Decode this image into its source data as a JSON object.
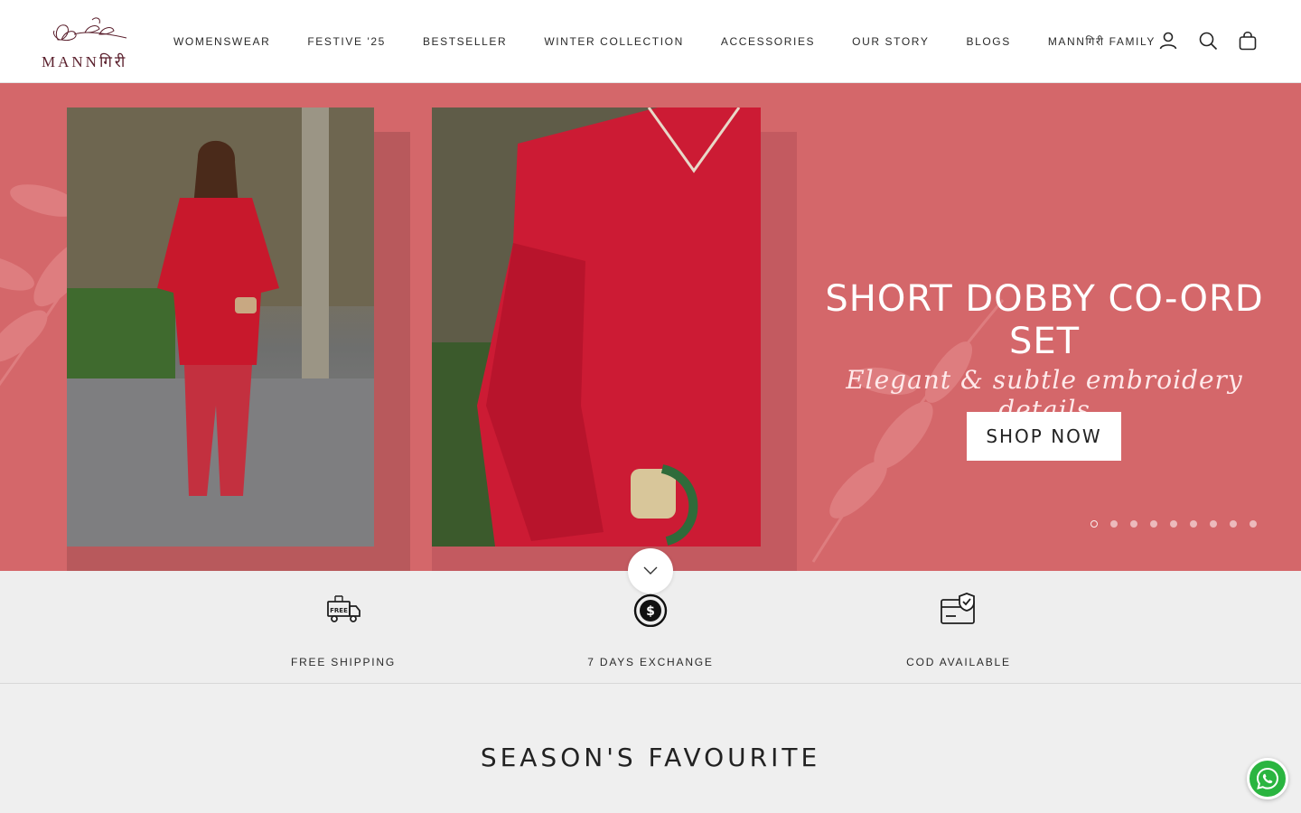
{
  "brand": {
    "logo_text": "MANNगिरी"
  },
  "nav": {
    "items": [
      {
        "label": "WOMENSWEAR"
      },
      {
        "label": "FESTIVE '25"
      },
      {
        "label": "BESTSELLER"
      },
      {
        "label": "WINTER COLLECTION"
      },
      {
        "label": "ACCESSORIES"
      },
      {
        "label": "OUR STORY"
      },
      {
        "label": "BLOGS"
      },
      {
        "label": "MANNगिरी FAMILY"
      }
    ],
    "icons": [
      "account-icon",
      "search-icon",
      "cart-icon"
    ]
  },
  "hero": {
    "title": "SHORT DOBBY CO-ORD SET",
    "subtitle": "Elegant & subtle embroidery details",
    "cta_label": "SHOP NOW",
    "slide_count": 9,
    "active_slide": 1,
    "background_color": "#d4676a"
  },
  "features": [
    {
      "icon": "free-delivery-truck-icon",
      "label": "FREE SHIPPING"
    },
    {
      "icon": "dollar-coin-icon",
      "label": "7 DAYS EXCHANGE"
    },
    {
      "icon": "cod-card-check-icon",
      "label": "COD AVAILABLE"
    }
  ],
  "section": {
    "title": "SEASON'S FAVOURITE"
  },
  "colors": {
    "accent": "#d4676a",
    "whatsapp": "#2ab540",
    "brand_text": "#5a1f2c"
  }
}
